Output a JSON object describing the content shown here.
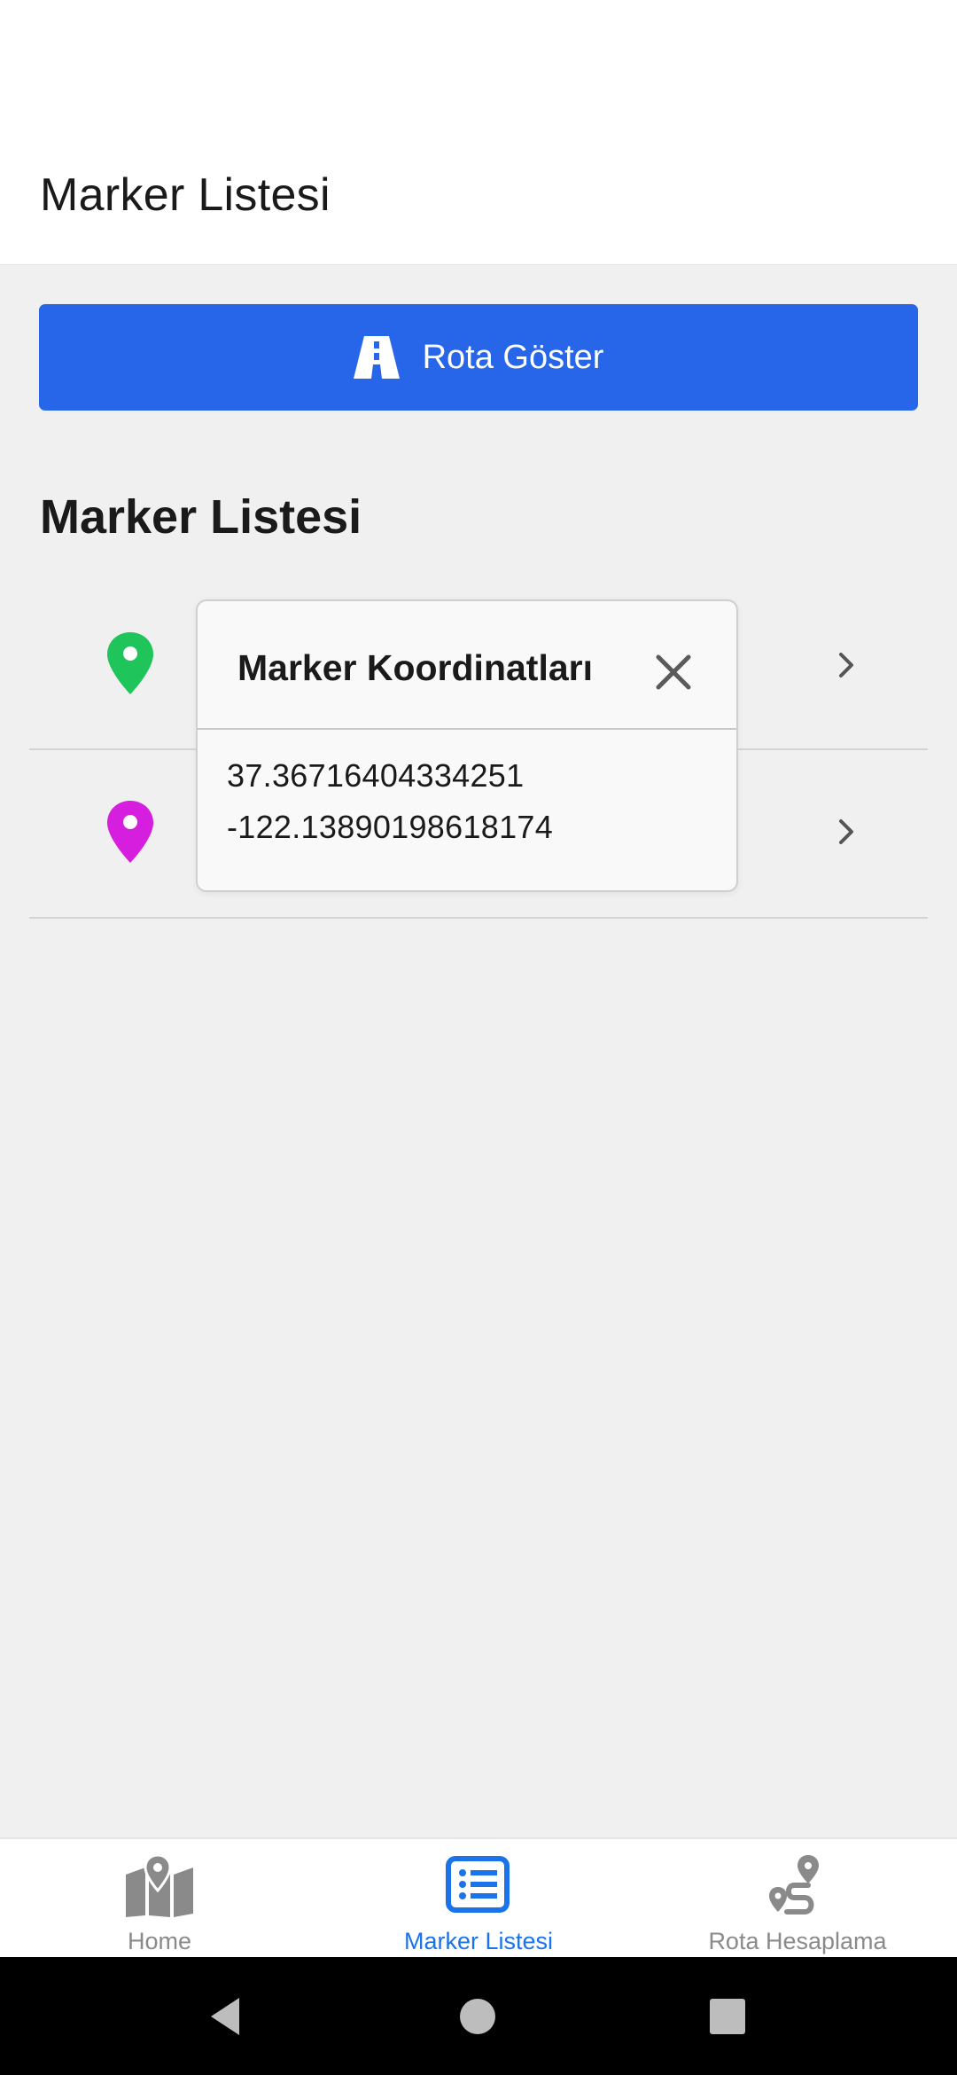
{
  "header": {
    "title": "Marker Listesi"
  },
  "route_button": {
    "label": "Rota Göster",
    "icon": "road-icon",
    "color": "#2766e8"
  },
  "section": {
    "title": "Marker Listesi"
  },
  "markers": [
    {
      "color": "#1fc45a",
      "icon": "map-pin-icon"
    },
    {
      "color": "#d61ede",
      "icon": "map-pin-icon"
    }
  ],
  "popup": {
    "title": "Marker Koordinatları",
    "latitude": "37.36716404334251",
    "longitude": "-122.13890198618174"
  },
  "tabs": [
    {
      "label": "Home",
      "icon": "map-icon",
      "active": false
    },
    {
      "label": "Marker Listesi",
      "icon": "list-icon",
      "active": true
    },
    {
      "label": "Rota Hesaplama",
      "icon": "route-icon",
      "active": false
    }
  ],
  "colors": {
    "accent": "#2766e8",
    "active_tab": "#1a73e8",
    "inactive_tab": "#8a8a8a"
  }
}
